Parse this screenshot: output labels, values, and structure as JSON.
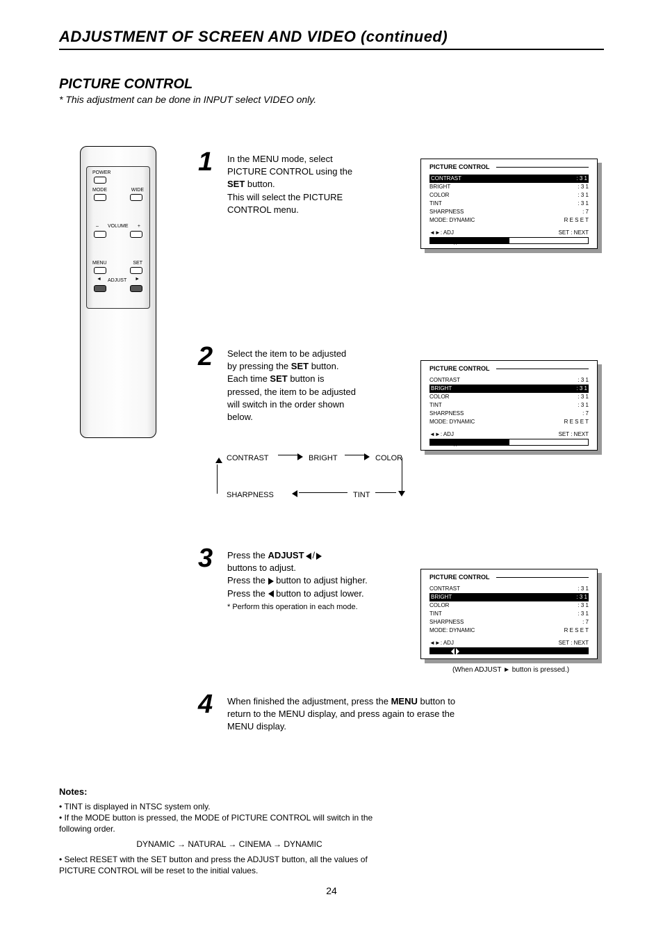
{
  "title": "ADJUSTMENT OF SCREEN AND VIDEO (continued)",
  "picture_heading": "PICTURE CONTROL",
  "picture_sub": "*  This adjustment can be done in INPUT select  VIDEO only.",
  "remote": {
    "power": "POWER",
    "mode": "MODE",
    "wide": "WIDE",
    "vol_minus": "–",
    "vol_label": "VOLUME",
    "vol_plus": "+",
    "menu": "MENU",
    "set": "SET",
    "adj_left": "◄",
    "adjust": "ADJUST",
    "adj_right": "►"
  },
  "steps": {
    "s1": {
      "n": "1",
      "l1": "In the MENU mode, select",
      "l2": "PICTURE CONTROL using the",
      "l3_a": "SET",
      "l3_b": " button.",
      "l4": "This will select the PICTURE",
      "l5": "CONTROL menu."
    },
    "s2": {
      "n": "2",
      "l1": "Select the item to be adjusted",
      "l2_a": "by pressing the ",
      "l2_b": "SET",
      "l2_c": " button.",
      "l3_a": "Each time ",
      "l3_b": "SET",
      "l3_c": " button is",
      "l4": "pressed, the item to be adjusted",
      "l5": "will switch in the order shown",
      "l6": "below."
    },
    "s3": {
      "n": "3",
      "l1_a": "Press the ",
      "l1_b": "ADJUST",
      "l2": " buttons to adjust.",
      "l3_a": "Press the ",
      "l3_b": " button to adjust higher.",
      "l4_a": "Press the ",
      "l4_b": " button to adjust lower.",
      "l5": "* Perform this operation in each mode."
    },
    "s4": {
      "n": "4",
      "l1_a": "When finished the adjustment, press the ",
      "l1_b": "MENU",
      "l1_c": " button to",
      "l2": "return to the MENU display, and press again to erase the",
      "l3": "MENU display."
    }
  },
  "cycle": {
    "a": "CONTRAST",
    "b": "BRIGHT",
    "c": "COLOR",
    "d": "SHARPNESS",
    "e": "TINT"
  },
  "osd": {
    "title": "PICTURE  CONTROL",
    "rows": [
      {
        "k": "CONTRAST",
        "v": ": 3 1"
      },
      {
        "k": "BRIGHT",
        "v": ": 3 1"
      },
      {
        "k": "COLOR",
        "v": ": 3 1"
      },
      {
        "k": "TINT",
        "v": ": 3 1"
      },
      {
        "k": "SHARPNESS",
        "v": ":   7"
      }
    ],
    "bar_left": "◄►: ADJ",
    "bar_right": "SET : NEXT",
    "mode_row_k": "MODE: DYNAMIC",
    "mode_row_v": "R E S E T"
  },
  "osd3_caption": "(When ADJUST ► button is pressed.)",
  "notes": {
    "hd": "Notes:",
    "l1": "• TINT is displayed in NTSC system only.",
    "l2": "• If the MODE button is pressed, the MODE of PICTURE CONTROL will switch in the",
    "l3": "  following order.",
    "seq": "DYNAMIC → NATURAL → CINEMA → DYNAMIC",
    "l4": "• Select RESET with the SET button and press the ADJUST button, all the values of",
    "l5": "  PICTURE CONTROL will be reset to the initial values."
  },
  "page_num": "24"
}
